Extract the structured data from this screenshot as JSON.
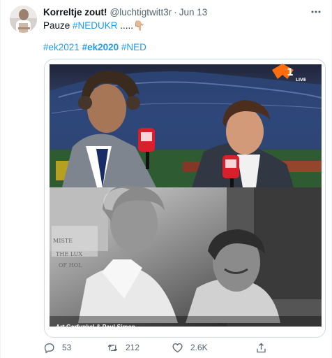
{
  "tweet": {
    "display_name": "Korreltje zout!",
    "handle": "@luchtigtwitt3r",
    "separator": "·",
    "timestamp": "Jun 13",
    "text_prefix": "Pauze ",
    "text_hashtag": "#NEDUKR",
    "text_suffix": " .....",
    "emoji": "👇🏼",
    "hashtags": [
      "#ek2021",
      "#ek2020",
      "#NED"
    ],
    "media_caption": "Art Garfunkel & Paul Simon",
    "broadcast_logo_text": "1",
    "broadcast_live_label": "LIVE"
  },
  "actions": {
    "replies": "53",
    "retweets": "212",
    "likes": "2.6K"
  },
  "icons": {
    "more": "more-icon",
    "reply": "reply-icon",
    "retweet": "retweet-icon",
    "like": "heart-icon",
    "share": "share-icon"
  },
  "colors": {
    "accent": "#1d9bf0",
    "secondary_text": "#536471",
    "primary_text": "#0f1419",
    "border": "#cfd9de",
    "npo_orange": "#ff6d0d",
    "microphone_red": "#d81f2a"
  }
}
